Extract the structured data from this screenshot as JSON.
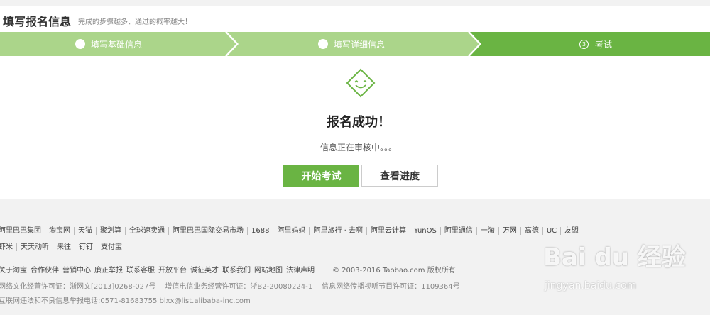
{
  "header": {
    "title": "填写报名信息",
    "subtitle": "完成的步骤越多、通过的概率越大！"
  },
  "steps": [
    {
      "label": "填写基础信息",
      "state": "done"
    },
    {
      "label": "填写详细信息",
      "state": "done"
    },
    {
      "number": "3",
      "label": "考试",
      "state": "active"
    }
  ],
  "colors": {
    "step_done": "#abd58a",
    "step_active": "#6ab443",
    "primary": "#6ab443"
  },
  "result": {
    "icon": "smile-diamond-icon",
    "title": "报名成功！",
    "message": "信息正在审核中。。。"
  },
  "buttons": {
    "start": "开始考试",
    "check": "查看进度"
  },
  "footer": {
    "row1": [
      "阿里巴巴集团",
      "淘宝网",
      "天猫",
      "聚划算",
      "全球速卖通",
      "阿里巴巴国际交易市场",
      "1688",
      "阿里妈妈",
      "阿里旅行 · 去啊",
      "阿里云计算",
      "YunOS",
      "阿里通信",
      "一淘",
      "万网",
      "高德",
      "UC",
      "友盟"
    ],
    "row2": [
      "虾米",
      "天天动听",
      "来往",
      "钉钉",
      "支付宝"
    ],
    "row3": [
      "关于淘宝",
      "合作伙伴",
      "营销中心",
      "廉正举报",
      "联系客服",
      "开放平台",
      "诚征英才",
      "联系我们",
      "网站地图",
      "法律声明"
    ],
    "copyright": "© 2003-2016 Taobao.com 版权所有",
    "licenses": [
      "网络文化经营许可证：浙网文[2013]0268-027号",
      "增值电信业务经营许可证：浙B2-20080224-1",
      "信息网络传播视听节目许可证：1109364号"
    ],
    "report": "互联网违法和不良信息举报电话:0571-81683755 blxx@list.alibaba-inc.com"
  },
  "watermark": {
    "logo": "Bai du 经验",
    "url": "jingyan.baidu.com"
  }
}
